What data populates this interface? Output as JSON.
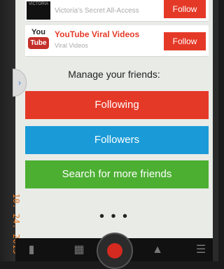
{
  "list": {
    "items": [
      {
        "thumb_text": "VICTORIA",
        "title": "",
        "subtitle": "Victoria's Secret All-Access",
        "button": "Follow"
      },
      {
        "thumb_text_top": "You",
        "thumb_text_bottom": "Tube",
        "title": "YouTube Viral Videos",
        "subtitle": "Viral Videos",
        "button": "Follow"
      }
    ]
  },
  "manage": {
    "heading": "Manage your friends:",
    "buttons": {
      "following": "Following",
      "followers": "Followers",
      "search": "Search for more friends"
    }
  },
  "more": "• • •",
  "side_tab": "›",
  "date_stamp": "10. 24. 2013",
  "nav": {
    "film": "▮",
    "grid": "▦",
    "people": "▲",
    "list": "☰"
  },
  "colors": {
    "red": "#e53927",
    "blue": "#1a9bd7",
    "green": "#4caf32"
  }
}
